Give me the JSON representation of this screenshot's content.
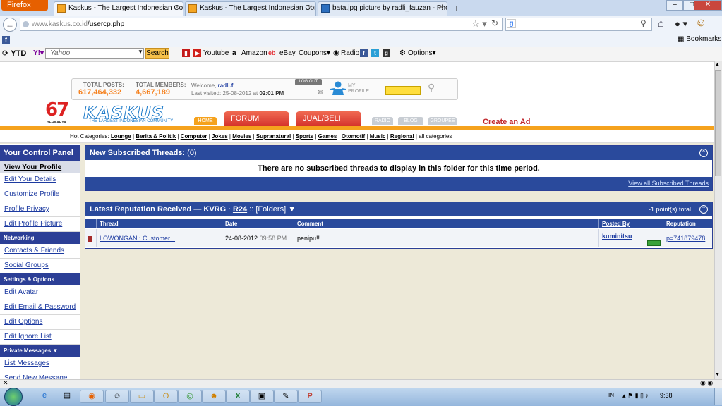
{
  "browser": {
    "menu_button": "Firefox",
    "tabs": [
      {
        "title": "Kaskus - The Largest Indonesian Com...",
        "active": true
      },
      {
        "title": "Kaskus - The Largest Indonesian Com...",
        "active": false
      },
      {
        "title": "bata.jpg picture by radli_fauzan - Pho...",
        "active": false
      }
    ],
    "new_tab": "+",
    "url_domain": "www.kaskus.co.id",
    "url_path": "/usercp.php",
    "bookmarks_label": "Bookmarks",
    "window_buttons": {
      "minimize": "–",
      "maximize": "□",
      "close": "✕"
    }
  },
  "toolbar": {
    "ytd": "YTD",
    "yahoo_placeholder": "Yahoo",
    "search_button": "Search",
    "items": [
      "Youtube",
      "Amazon",
      "eBay",
      "Coupons",
      "Radio",
      "Options"
    ]
  },
  "header": {
    "total_posts_label": "TOTAL POSTS:",
    "total_posts": "617,464,332",
    "total_members_label": "TOTAL MEMBERS:",
    "total_members": "4,667,189",
    "welcome_prefix": "Welcome,",
    "username": "radli.f",
    "last_visited_prefix": "Last visited: 25-08-2012 at",
    "last_visited_time": "02:01 PM",
    "logout": "LOG OUT",
    "my_profile_1": "MY",
    "my_profile_2": "PROFILE",
    "logo_number": "67",
    "logo_sub": "BERKARYA",
    "logo_text": "KASKUS",
    "logo_tagline": "THE LARGEST INDONESIAN COMMUNITY",
    "nav": {
      "home": "HOME",
      "forum": "FORUM",
      "jualbeli": "JUAL/BELI",
      "radio": "RADIO",
      "blog": "BLOG",
      "groupee": "GROUPEE"
    },
    "create_ad": "Create an Ad"
  },
  "hot_categories": {
    "label": "Hot Categories:",
    "items": [
      "Lounge",
      "Berita & Politik",
      "Computer",
      "Jokes",
      "Movies",
      "Supranatural",
      "Sports",
      "Games",
      "Otomotif",
      "Music",
      "Regional"
    ],
    "all": "all categories"
  },
  "sidebar": {
    "title": "Your Control Panel",
    "profile_items": [
      "View Your Profile",
      "Edit Your Details",
      "Customize Profile",
      "Profile Privacy",
      "Edit Profile Picture"
    ],
    "networking_title": "Networking",
    "networking_items": [
      "Contacts & Friends",
      "Social Groups"
    ],
    "settings_title": "Settings & Options",
    "settings_items": [
      "Edit Avatar",
      "Edit Email & Password",
      "Edit Options",
      "Edit Ignore List"
    ],
    "pm_title": "Private Messages ▼",
    "pm_items": [
      "List Messages",
      "Send New Message"
    ]
  },
  "subscribed": {
    "title": "New Subscribed Threads:",
    "count": "(0)",
    "message": "There are no subscribed threads to display in this folder for this time period.",
    "view_all": "View all Subscribed Threads"
  },
  "reputation": {
    "title_prefix": "Latest Reputation Received — KVRG · ",
    "title_link": "R24",
    "title_suffix": ":: [Folders] ▼",
    "total": "-1 point(s) total",
    "columns": [
      "Thread",
      "Date",
      "Comment",
      "Posted By",
      "Reputation"
    ],
    "rows": [
      {
        "thread": "LOWONGAN : Customer...",
        "date": "24-08-2012",
        "time": "09:58 PM",
        "comment": "penipu!!",
        "posted_by": "kuminitsu",
        "reputation": "p=741879478"
      }
    ]
  },
  "taskbar": {
    "language": "IN",
    "clock": "9:38"
  }
}
